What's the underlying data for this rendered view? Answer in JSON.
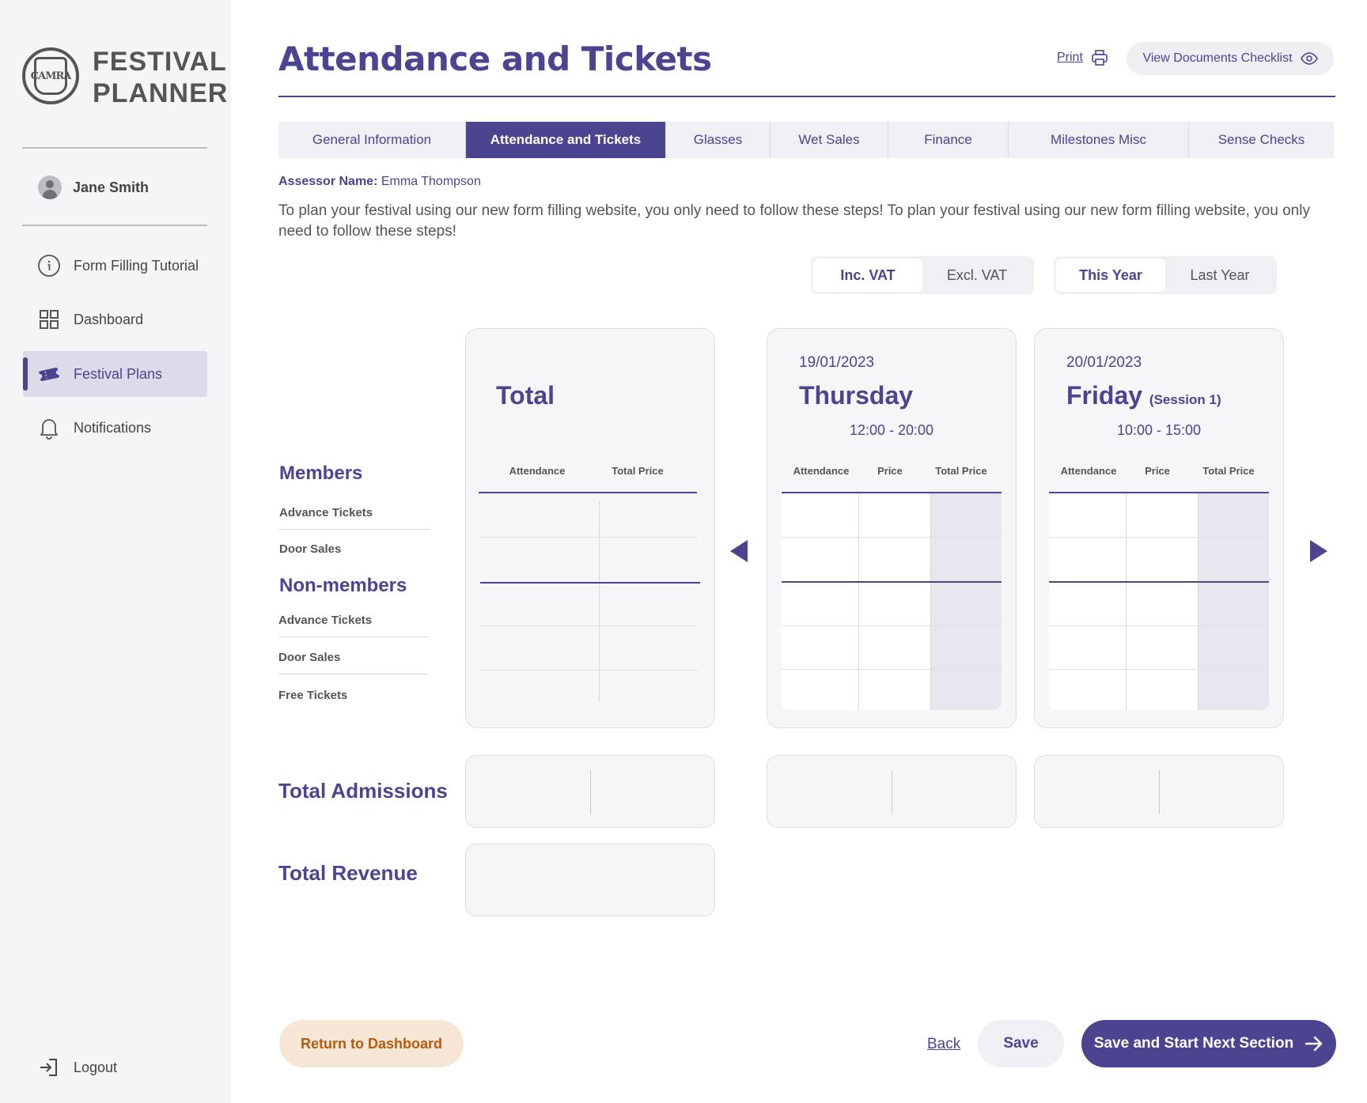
{
  "sidebar": {
    "logo_text": "CAMRA",
    "brand_line1": "FESTIVAL",
    "brand_line2": "PLANNER",
    "user_name": "Jane Smith",
    "items": [
      {
        "label": "Form Filling Tutorial",
        "icon": "info-icon"
      },
      {
        "label": "Dashboard",
        "icon": "grid-icon"
      },
      {
        "label": "Festival Plans",
        "icon": "ticket-icon",
        "active": true
      },
      {
        "label": "Notifications",
        "icon": "bell-icon"
      }
    ],
    "logout_label": "Logout"
  },
  "header": {
    "title": "Attendance and Tickets",
    "print_label": "Print",
    "checklist_label": "View Documents Checklist"
  },
  "tabs": [
    {
      "label": "General Information"
    },
    {
      "label": "Attendance and Tickets",
      "active": true
    },
    {
      "label": "Glasses"
    },
    {
      "label": "Wet Sales"
    },
    {
      "label": "Finance"
    },
    {
      "label": "Milestones Misc"
    },
    {
      "label": "Sense Checks"
    }
  ],
  "assessor": {
    "label": "Assessor Name:",
    "name": "Emma Thompson"
  },
  "intro": "To plan your festival using our new form filling website, you only need to follow these steps! To plan your festival using our new form filling website, you only need to follow these steps!",
  "toggles": {
    "vat": {
      "on": "Inc. VAT",
      "off": "Excl. VAT"
    },
    "year": {
      "on": "This Year",
      "off": "Last Year"
    }
  },
  "rows": {
    "members": "Members",
    "members_advance": "Advance Tickets",
    "members_door": "Door Sales",
    "nonmembers": "Non-members",
    "nonmembers_advance": "Advance Tickets",
    "nonmembers_door": "Door Sales",
    "free": "Free Tickets",
    "total_admissions": "Total Admissions",
    "total_revenue": "Total Revenue"
  },
  "cards": {
    "total": {
      "title": "Total",
      "col1": "Attendance",
      "col2": "Total Price"
    },
    "thursday": {
      "date": "19/01/2023",
      "day": "Thursday",
      "session": "",
      "time": "12:00 - 20:00",
      "col1": "Attendance",
      "col2": "Price",
      "col3": "Total Price"
    },
    "friday": {
      "date": "20/01/2023",
      "day": "Friday",
      "session": "(Session 1)",
      "time": "10:00 - 15:00",
      "col1": "Attendance",
      "col2": "Price",
      "col3": "Total Price"
    }
  },
  "footer": {
    "return_label": "Return to Dashboard",
    "back_label": "Back",
    "save_label": "Save",
    "next_label": "Save and Start Next Section"
  },
  "colors": {
    "accent": "#4b4591",
    "return_bg": "#f7e6d6",
    "return_text": "#b55a10"
  }
}
